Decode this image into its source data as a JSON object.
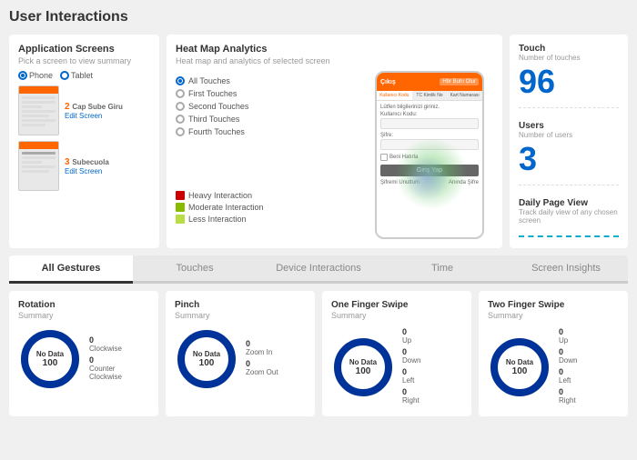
{
  "page": {
    "title": "User Interactions"
  },
  "appScreens": {
    "title": "Application Screens",
    "subtitle": "Pick a screen to view summary",
    "radioOptions": [
      "Phone",
      "Tablet"
    ],
    "selectedRadio": "Phone",
    "screens": [
      {
        "num": "2",
        "name": "Cap Sube Giru",
        "editLabel": "Edit Screen"
      },
      {
        "num": "3",
        "name": "Subecuola",
        "editLabel": "Edit Screen"
      }
    ]
  },
  "heatmap": {
    "title": "Heat Map Analytics",
    "subtitle": "Heat map and analytics of selected screen",
    "touchOptions": [
      {
        "label": "All Touches",
        "active": true
      },
      {
        "label": "First Touches",
        "active": false
      },
      {
        "label": "Second Touches",
        "active": false
      },
      {
        "label": "Third Touches",
        "active": false
      },
      {
        "label": "Fourth Touches",
        "active": false
      }
    ],
    "legend": [
      {
        "label": "Heavy Interaction",
        "color": "#cc0000"
      },
      {
        "label": "Moderate Interaction",
        "color": "#99cc00"
      },
      {
        "label": "Less Interaction",
        "color": "#ccee66"
      }
    ],
    "phone": {
      "headerText": "Çıkış",
      "headerBtn1": "Hbr Buhı Olur",
      "tabLabels": [
        "Kullanıcı Kodu",
        "TC Kimlik No",
        "Kart Numarası"
      ],
      "bodyLabel": "Lütfen bilgilerinizi giriniz.",
      "inputLabel": "Kullanıcı Kodu:",
      "sifre": "Şifre:",
      "rememberLabel": "Beni Hatırla",
      "loginBtn": "Giriş Yap",
      "footer1": "Şifremi Unuttum",
      "footer2": "Anında Şifre"
    }
  },
  "stats": {
    "touch": {
      "label": "Touch",
      "sub": "Number of touches",
      "value": "96"
    },
    "users": {
      "label": "Users",
      "sub": "Number of users",
      "value": "3"
    },
    "dpv": {
      "label": "Daily Page View",
      "sub": "Track daily view of any chosen screen"
    }
  },
  "tabs": [
    {
      "label": "All Gestures",
      "active": true
    },
    {
      "label": "Touches",
      "active": false
    },
    {
      "label": "Device Interactions",
      "active": false
    },
    {
      "label": "Time",
      "active": false
    },
    {
      "label": "Screen Insights",
      "active": false
    }
  ],
  "gestures": [
    {
      "title": "Rotation",
      "sub": "Summary",
      "stats": [
        {
          "label": "Clockwise",
          "value": "0"
        },
        {
          "label": "Counter Clockwise",
          "value": "0"
        }
      ]
    },
    {
      "title": "Pinch",
      "sub": "Summary",
      "stats": [
        {
          "label": "Zoom In",
          "value": "0"
        },
        {
          "label": "Zoom Out",
          "value": "0"
        }
      ]
    },
    {
      "title": "One Finger Swipe",
      "sub": "Summary",
      "stats": [
        {
          "label": "Up",
          "value": "0"
        },
        {
          "label": "Down",
          "value": "0"
        },
        {
          "label": "Left",
          "value": "0"
        },
        {
          "label": "Right",
          "value": "0"
        }
      ]
    },
    {
      "title": "Two Finger Swipe",
      "sub": "Summary",
      "stats": [
        {
          "label": "Up",
          "value": "0"
        },
        {
          "label": "Down",
          "value": "0"
        },
        {
          "label": "Left",
          "value": "0"
        },
        {
          "label": "Right",
          "value": "0"
        }
      ]
    }
  ],
  "donut": {
    "noDataLabel": "No Data",
    "centerNum": "100",
    "strokeColor": "#003399",
    "bgColor": "#e0e0e0"
  },
  "colors": {
    "accent": "#ff6600",
    "blue": "#0066cc",
    "darkBlue": "#003399"
  }
}
